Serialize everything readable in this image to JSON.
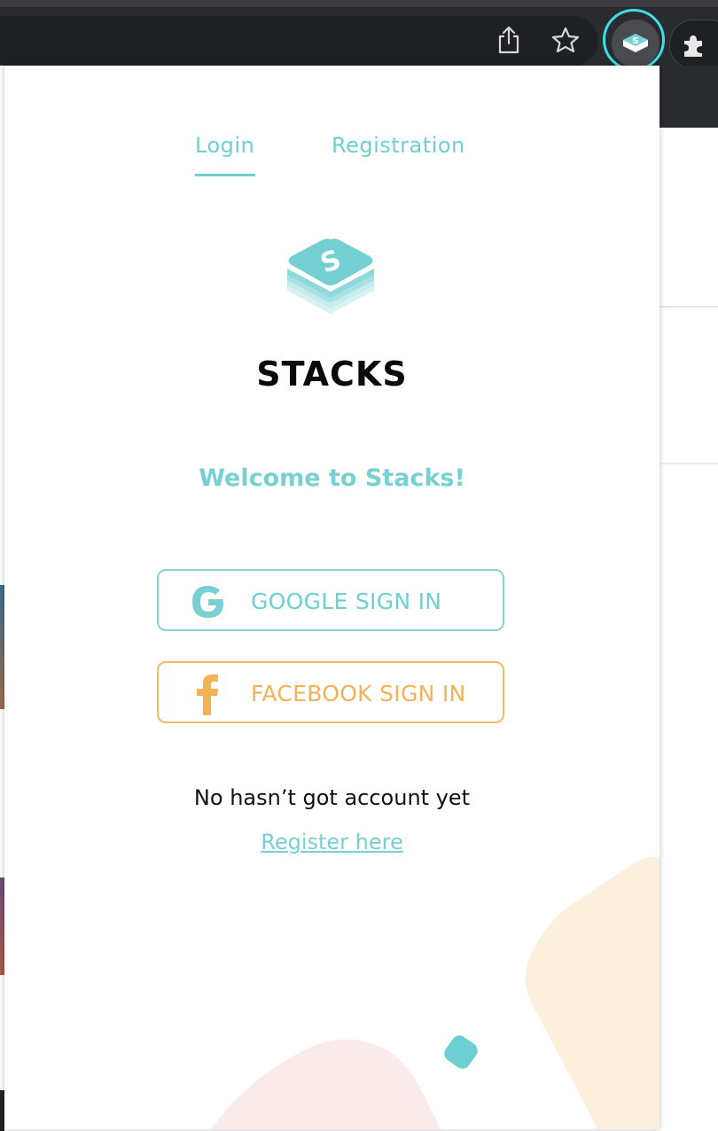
{
  "browser": {
    "share_icon": "share-icon",
    "bookmark_icon": "star-icon",
    "extension_icon": "stacks-extension-icon",
    "puzzle_icon": "puzzle-icon"
  },
  "popup": {
    "tabs": [
      {
        "label": "Login",
        "active": true
      },
      {
        "label": "Registration",
        "active": false
      }
    ],
    "brand": "STACKS",
    "welcome": "Welcome to Stacks!",
    "google_button": "GOOGLE SIGN IN",
    "facebook_button": "FACEBOOK SIGN IN",
    "no_account_text": "No hasn’t got account yet",
    "register_link": "Register here"
  },
  "colors": {
    "accent": "#6ecfd3",
    "facebook": "#f2b256",
    "text": "#111111"
  }
}
